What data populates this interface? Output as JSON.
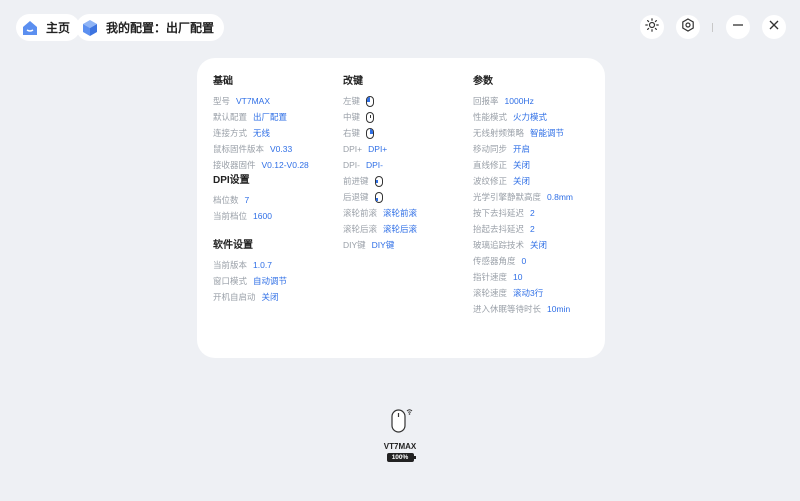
{
  "header": {
    "home_label": "主页",
    "config_label": "我的配置：出厂配置"
  },
  "basic": {
    "title": "基础",
    "items": [
      {
        "label": "型号",
        "value": "VT7MAX"
      },
      {
        "label": "默认配置",
        "value": "出厂配置"
      },
      {
        "label": "连接方式",
        "value": "无线"
      },
      {
        "label": "鼠标固件版本",
        "value": "V0.33"
      },
      {
        "label": "接收器固件",
        "value": "V0.12-V0.28"
      }
    ]
  },
  "dpi": {
    "title": "DPI设置",
    "items": [
      {
        "label": "档位数",
        "value": "7"
      },
      {
        "label": "当前档位",
        "value": "1600"
      }
    ]
  },
  "software": {
    "title": "软件设置",
    "items": [
      {
        "label": "当前版本",
        "value": "1.0.7"
      },
      {
        "label": "窗口模式",
        "value": "自动调节"
      },
      {
        "label": "开机自启动",
        "value": "关闭"
      }
    ]
  },
  "keys": {
    "title": "改键",
    "items": [
      {
        "label": "左键",
        "icon": "mouse-left-button-icon"
      },
      {
        "label": "中键",
        "icon": "mouse-middle-button-icon"
      },
      {
        "label": "右键",
        "icon": "mouse-right-button-icon"
      },
      {
        "label": "DPI+",
        "value": "DPI+"
      },
      {
        "label": "DPI-",
        "value": "DPI-"
      },
      {
        "label": "前进键",
        "icon": "mouse-forward-button-icon"
      },
      {
        "label": "后退键",
        "icon": "mouse-back-button-icon"
      },
      {
        "label": "滚轮前滚",
        "value": "滚轮前滚"
      },
      {
        "label": "滚轮后滚",
        "value": "滚轮后滚"
      },
      {
        "label": "DIY键",
        "value": "DIY键"
      }
    ]
  },
  "params": {
    "title": "参数",
    "items": [
      {
        "label": "回报率",
        "value": "1000Hz"
      },
      {
        "label": "性能模式",
        "value": "火力模式"
      },
      {
        "label": "无线射频策略",
        "value": "智能调节"
      },
      {
        "label": "移动同步",
        "value": "开启"
      },
      {
        "label": "直线修正",
        "value": "关闭"
      },
      {
        "label": "波纹修正",
        "value": "关闭"
      },
      {
        "label": "光学引擎静默高度",
        "value": "0.8mm"
      },
      {
        "label": "按下去抖延迟",
        "value": "2"
      },
      {
        "label": "抬起去抖延迟",
        "value": "2"
      },
      {
        "label": "玻璃追踪技术",
        "value": "关闭"
      },
      {
        "label": "传感器角度",
        "value": "0"
      },
      {
        "label": "指针速度",
        "value": "10"
      },
      {
        "label": "滚轮速度",
        "value": "滚动3行"
      },
      {
        "label": "进入休眠等待时长",
        "value": "10min"
      }
    ]
  },
  "device": {
    "name": "VT7MAX",
    "battery": "100%"
  },
  "colors": {
    "accent": "#2f6fe6",
    "background": "#eef0f4"
  }
}
